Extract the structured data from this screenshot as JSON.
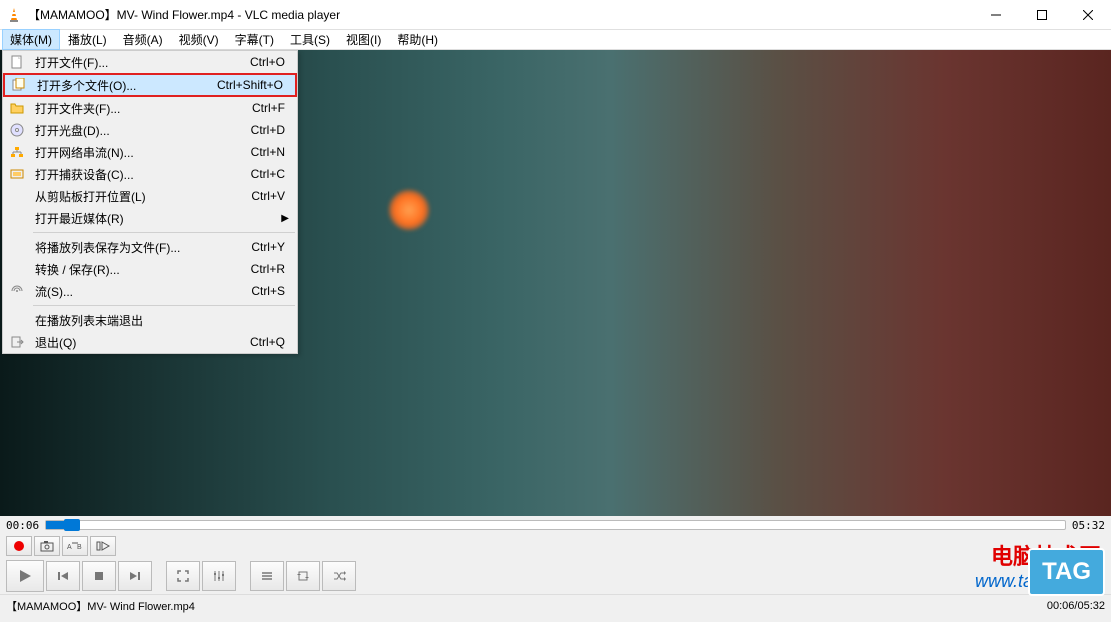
{
  "window": {
    "title": "【MAMAMOO】MV- Wind Flower.mp4 - VLC media player"
  },
  "menubar": [
    {
      "label": "媒体(M)",
      "active": true
    },
    {
      "label": "播放(L)"
    },
    {
      "label": "音频(A)"
    },
    {
      "label": "视频(V)"
    },
    {
      "label": "字幕(T)"
    },
    {
      "label": "工具(S)"
    },
    {
      "label": "视图(I)"
    },
    {
      "label": "帮助(H)"
    }
  ],
  "dropdown": {
    "items": [
      {
        "icon": "file",
        "label": "打开文件(F)...",
        "shortcut": "Ctrl+O"
      },
      {
        "icon": "files",
        "label": "打开多个文件(O)...",
        "shortcut": "Ctrl+Shift+O",
        "highlighted": true
      },
      {
        "icon": "folder",
        "label": "打开文件夹(F)...",
        "shortcut": "Ctrl+F"
      },
      {
        "icon": "disc",
        "label": "打开光盘(D)...",
        "shortcut": "Ctrl+D"
      },
      {
        "icon": "network",
        "label": "打开网络串流(N)...",
        "shortcut": "Ctrl+N"
      },
      {
        "icon": "capture",
        "label": "打开捕获设备(C)...",
        "shortcut": "Ctrl+C"
      },
      {
        "icon": "",
        "label": "从剪贴板打开位置(L)",
        "shortcut": "Ctrl+V"
      },
      {
        "icon": "",
        "label": "打开最近媒体(R)",
        "shortcut": "",
        "submenu": true
      },
      {
        "sep": true
      },
      {
        "icon": "",
        "label": "将播放列表保存为文件(F)...",
        "shortcut": "Ctrl+Y"
      },
      {
        "icon": "",
        "label": "转换 / 保存(R)...",
        "shortcut": "Ctrl+R"
      },
      {
        "icon": "stream",
        "label": "流(S)...",
        "shortcut": "Ctrl+S"
      },
      {
        "sep": true
      },
      {
        "icon": "",
        "label": "在播放列表末端退出",
        "shortcut": ""
      },
      {
        "icon": "quit",
        "label": "退出(Q)",
        "shortcut": "Ctrl+Q"
      }
    ]
  },
  "playback": {
    "current_time": "00:06",
    "total_time": "05:32"
  },
  "status": {
    "filename": "【MAMAMOO】MV- Wind Flower.mp4",
    "time_display": "00:06/05:32"
  },
  "watermark": {
    "line1": "电脑技术网",
    "line2": "www.tagxp.com",
    "badge": "TAG"
  }
}
